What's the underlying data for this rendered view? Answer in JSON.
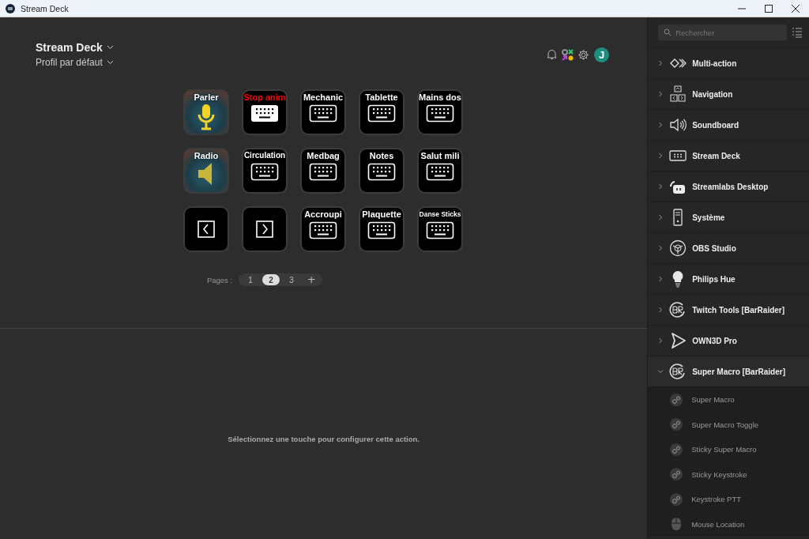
{
  "window": {
    "title": "Stream Deck"
  },
  "header": {
    "device": "Stream Deck",
    "profile": "Profil par défaut",
    "avatar": "J"
  },
  "keys": [
    {
      "kind": "mic",
      "title": "Parler",
      "color": "#ffffff"
    },
    {
      "kind": "keyboard-filled",
      "title": "Stop anim",
      "color": "#ff0000"
    },
    {
      "kind": "keyboard",
      "title": "Mechanic",
      "color": "#ffffff"
    },
    {
      "kind": "keyboard",
      "title": "Tablette",
      "color": "#ffffff"
    },
    {
      "kind": "keyboard",
      "title": "Mains dos",
      "color": "#ffffff"
    },
    {
      "kind": "speaker",
      "title": "Radio",
      "color": "#ffffff"
    },
    {
      "kind": "keyboard",
      "title": "Circulation",
      "color": "#ffffff"
    },
    {
      "kind": "keyboard",
      "title": "Medbag",
      "color": "#ffffff"
    },
    {
      "kind": "keyboard",
      "title": "Notes",
      "color": "#ffffff"
    },
    {
      "kind": "keyboard",
      "title": "Salut mili",
      "color": "#ffffff"
    },
    {
      "kind": "prev"
    },
    {
      "kind": "next"
    },
    {
      "kind": "keyboard",
      "title": "Accroupi",
      "color": "#ffffff"
    },
    {
      "kind": "keyboard",
      "title": "Plaquette",
      "color": "#ffffff"
    },
    {
      "kind": "keyboard",
      "title": "Danse Sticks",
      "color": "#ffffff"
    }
  ],
  "pages": {
    "label": "Pages :",
    "items": [
      {
        "label": "1",
        "selected": false
      },
      {
        "label": "2",
        "selected": true
      },
      {
        "label": "3",
        "selected": false
      }
    ],
    "add": "+"
  },
  "properties": {
    "hint": "Sélectionnez une touche pour configurer cette action."
  },
  "sidebar": {
    "search": {
      "placeholder": "Rechercher"
    },
    "items": [
      {
        "kind": "multi",
        "label": "Multi-action",
        "expanded": false
      },
      {
        "kind": "navigation",
        "label": "Navigation",
        "expanded": false
      },
      {
        "kind": "sound",
        "label": "Soundboard",
        "expanded": false
      },
      {
        "kind": "deck",
        "label": "Stream Deck",
        "expanded": false
      },
      {
        "kind": "streamlabs",
        "label": "Streamlabs Desktop",
        "expanded": false
      },
      {
        "kind": "system",
        "label": "Système",
        "expanded": false
      },
      {
        "kind": "obs",
        "label": "OBS Studio",
        "expanded": false
      },
      {
        "kind": "bulb",
        "label": "Philips Hue",
        "expanded": false
      },
      {
        "kind": "br",
        "label": "Twitch Tools [BarRaider]",
        "expanded": false
      },
      {
        "kind": "own3d",
        "label": "OWN3D Pro",
        "expanded": false
      },
      {
        "kind": "br",
        "label": "Super Macro [BarRaider]",
        "expanded": true,
        "children": [
          {
            "kind": "gears",
            "label": "Super Macro"
          },
          {
            "kind": "gears",
            "label": "Super Macro Toggle"
          },
          {
            "kind": "gears",
            "label": "Sticky Super Macro"
          },
          {
            "kind": "gears",
            "label": "Sticky Keystroke"
          },
          {
            "kind": "gears",
            "label": "Keystroke PTT"
          },
          {
            "kind": "mouse",
            "label": "Mouse Location"
          }
        ]
      }
    ]
  }
}
